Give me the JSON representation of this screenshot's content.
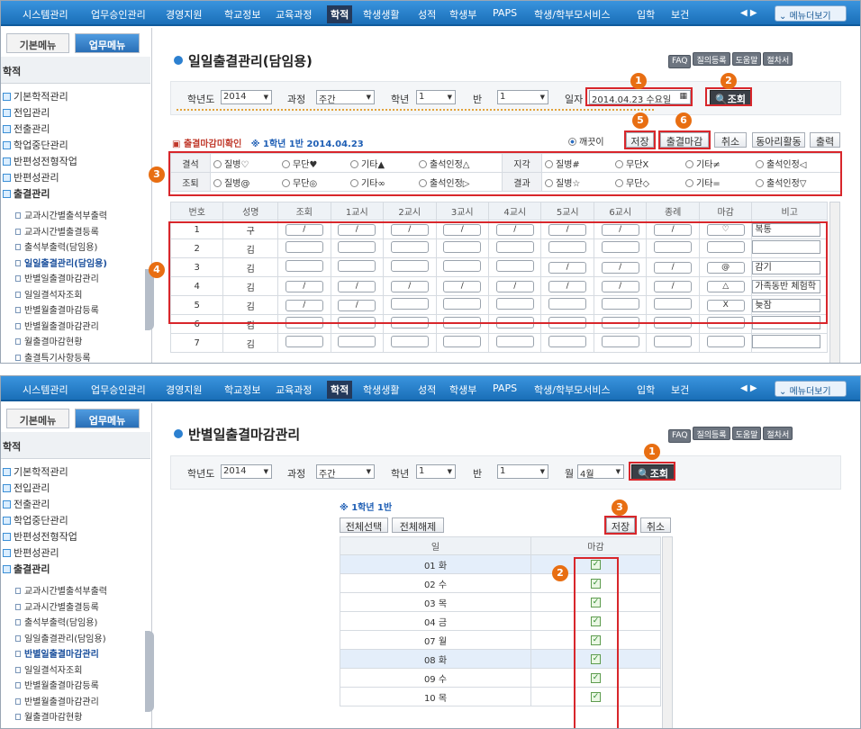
{
  "nav": {
    "items": [
      "시스템관리",
      "업무승인관리",
      "경영지원",
      "학교정보",
      "교육과정",
      "학적",
      "학생생활",
      "성적",
      "학생부",
      "PAPS",
      "학생/학부모서비스",
      "입학",
      "보건"
    ],
    "active": "학적",
    "arrows": "◀ ▶",
    "menu_all": "메뉴더보기"
  },
  "sidebar": {
    "tab_basic": "기본메뉴",
    "tab_work": "업무메뉴",
    "section": "학적",
    "level1": [
      "기본학적관리",
      "전입관리",
      "전출관리",
      "학업중단관리",
      "반편성전형작업",
      "반편성관리",
      "출결관리"
    ],
    "p1_level2": [
      "교과시간별출석부출력",
      "교과시간별출결등록",
      "출석부출력(담임용)",
      "일일출결관리(담임용)",
      "반별일출결마감관리",
      "일일결석자조회",
      "반별월출결마감등록",
      "반별월출결마감관리",
      "월출결마감현황",
      "출결특기사항등록"
    ],
    "p2_level2": [
      "교과시간별출석부출력",
      "교과시간별출결등록",
      "출석부출력(담임용)",
      "일일출결관리(담임용)",
      "반별일출결마감관리",
      "일일결석자조회",
      "반별월출결마감등록",
      "반별월출결마감관리",
      "월출결마감현황"
    ]
  },
  "header_buttons": [
    "FAQ",
    "질의등록",
    "도움말",
    "절차서"
  ],
  "panel1": {
    "title": "일일출결관리(담임용)",
    "filter": {
      "year_label": "학년도",
      "year": "2014",
      "course_label": "과정",
      "course": "주간",
      "grade_label": "학년",
      "grade": "1",
      "class_label": "반",
      "class": "1",
      "date_label": "일자",
      "date": "2014.04.23 수요일",
      "search": "조회"
    },
    "status_prefix": "출결마감미확인",
    "status_info": "※ 1학년 1반 2014.04.23",
    "clean_label": "깨끗이",
    "btn_save": "저장",
    "btn_close": "출결마감",
    "btn_cancel": "취소",
    "btn_club": "동아리활동",
    "btn_print": "출력",
    "att_rows": [
      {
        "h1": "결석",
        "opts1": [
          "질병♡",
          "무단♥",
          "기타▲",
          "출석인정△"
        ],
        "h2": "지각",
        "opts2": [
          "질병#",
          "무단X",
          "기타≠",
          "출석인정◁"
        ]
      },
      {
        "h1": "조퇴",
        "opts1": [
          "질병@",
          "무단◎",
          "기타∞",
          "출석인정▷"
        ],
        "h2": "결과",
        "opts2": [
          "질병☆",
          "무단◇",
          "기타=",
          "출석인정▽"
        ]
      }
    ],
    "columns": [
      "번호",
      "성명",
      "조회",
      "1교시",
      "2교시",
      "3교시",
      "4교시",
      "5교시",
      "6교시",
      "종례",
      "마감",
      "비고"
    ],
    "rows": [
      {
        "no": "1",
        "name": "구",
        "slash": [
          1,
          1,
          1,
          1,
          1,
          1,
          1,
          1
        ],
        "close": "♡",
        "memo": "복통"
      },
      {
        "no": "2",
        "name": "김",
        "slash": [
          0,
          0,
          0,
          0,
          0,
          0,
          0,
          0
        ],
        "close": "",
        "memo": ""
      },
      {
        "no": "3",
        "name": "김",
        "slash": [
          0,
          0,
          0,
          0,
          0,
          1,
          1,
          1
        ],
        "close": "@",
        "memo": "감기"
      },
      {
        "no": "4",
        "name": "김",
        "slash": [
          1,
          1,
          1,
          1,
          1,
          1,
          1,
          1
        ],
        "close": "△",
        "memo": "가족동반 체험학"
      },
      {
        "no": "5",
        "name": "김",
        "slash": [
          1,
          1,
          0,
          0,
          0,
          0,
          0,
          0
        ],
        "close": "X",
        "memo": "늦잠"
      },
      {
        "no": "6",
        "name": "김",
        "slash": [
          0,
          0,
          0,
          0,
          0,
          0,
          0,
          0
        ],
        "close": "",
        "memo": ""
      },
      {
        "no": "7",
        "name": "김",
        "slash": [
          0,
          0,
          0,
          0,
          0,
          0,
          0,
          0
        ],
        "close": "",
        "memo": ""
      }
    ],
    "badges": [
      "1",
      "2",
      "3",
      "4",
      "5",
      "6"
    ]
  },
  "panel2": {
    "title": "반별일출결마감관리",
    "filter": {
      "year_label": "학년도",
      "year": "2014",
      "course_label": "과정",
      "course": "주간",
      "grade_label": "학년",
      "grade": "1",
      "class_label": "반",
      "class": "1",
      "month_label": "월",
      "month": "4월",
      "search": "조회"
    },
    "class_info": "※ 1학년 1반",
    "btn_select_all": "전체선택",
    "btn_clear_all": "전체해제",
    "btn_save": "저장",
    "btn_cancel": "취소",
    "columns": [
      "일",
      "마감"
    ],
    "days": [
      "01 화",
      "02 수",
      "03 목",
      "04 금",
      "07 월",
      "08 화",
      "09 수",
      "10 목"
    ],
    "checked": [
      true,
      true,
      true,
      true,
      true,
      true,
      true,
      true
    ],
    "badges": [
      "1",
      "2",
      "3"
    ]
  }
}
